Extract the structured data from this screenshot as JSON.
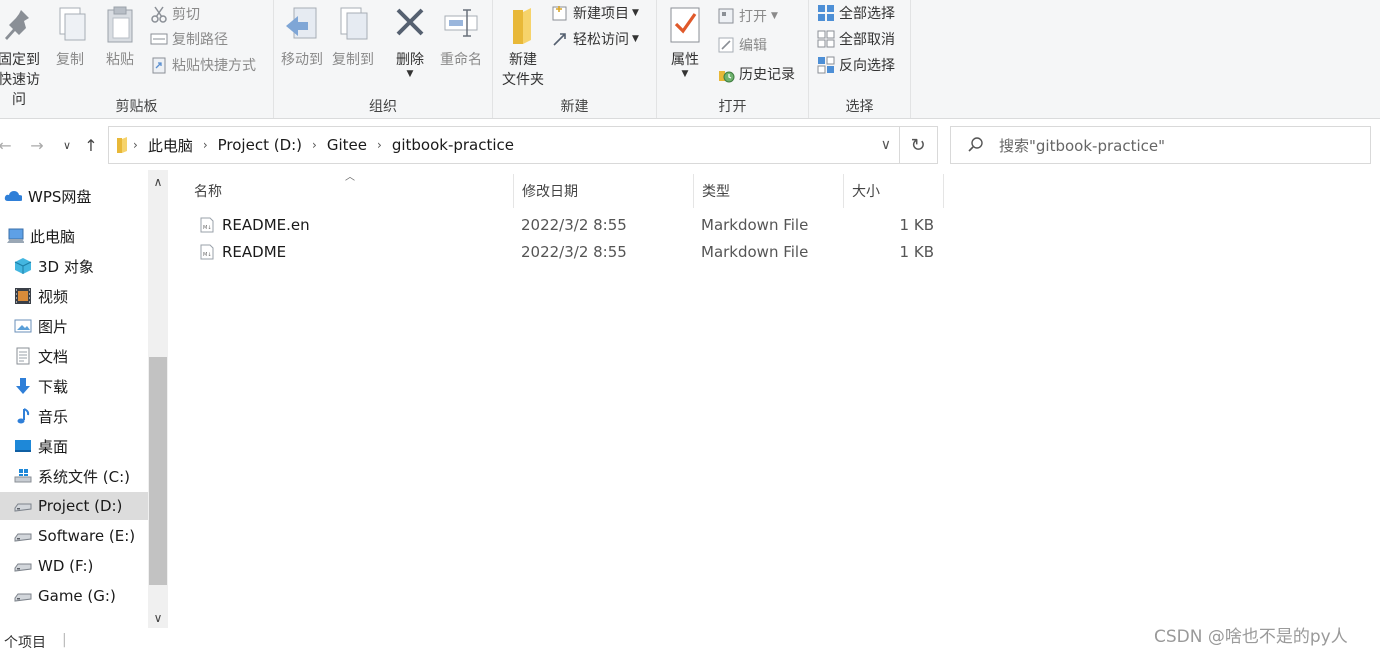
{
  "ribbon": {
    "clipboard": {
      "label": "剪贴板",
      "pin_line1": "固定到",
      "pin_line2": "快速访问",
      "copy": "复制",
      "paste": "粘贴",
      "cut": "剪切",
      "copy_path": "复制路径",
      "paste_shortcut": "粘贴快捷方式"
    },
    "organize": {
      "label": "组织",
      "move_to": "移动到",
      "copy_to": "复制到",
      "delete": "删除",
      "rename": "重命名"
    },
    "new": {
      "label": "新建",
      "new_folder_line1": "新建",
      "new_folder_line2": "文件夹",
      "new_item": "新建项目",
      "easy_access": "轻松访问"
    },
    "open": {
      "label": "打开",
      "properties": "属性",
      "open": "打开",
      "edit": "编辑",
      "history": "历史记录"
    },
    "select": {
      "label": "选择",
      "select_all": "全部选择",
      "select_none": "全部取消",
      "invert": "反向选择"
    }
  },
  "address": {
    "crumbs": [
      "此电脑",
      "Project (D:)",
      "Gitee",
      "gitbook-practice"
    ],
    "search_placeholder": "搜索\"gitbook-practice\""
  },
  "sidebar": {
    "items": [
      {
        "label": "WPS网盘",
        "icon": "cloud-icon"
      },
      {
        "label": "此电脑",
        "icon": "computer-icon"
      },
      {
        "label": "3D 对象",
        "icon": "3d-objects-icon"
      },
      {
        "label": "视频",
        "icon": "video-icon"
      },
      {
        "label": "图片",
        "icon": "pictures-icon"
      },
      {
        "label": "文档",
        "icon": "documents-icon"
      },
      {
        "label": "下载",
        "icon": "download-icon"
      },
      {
        "label": "音乐",
        "icon": "music-icon"
      },
      {
        "label": "桌面",
        "icon": "desktop-icon"
      },
      {
        "label": "系统文件 (C:)",
        "icon": "windows-drive-icon"
      },
      {
        "label": "Project (D:)",
        "icon": "drive-icon"
      },
      {
        "label": "Software (E:)",
        "icon": "drive-icon"
      },
      {
        "label": "WD (F:)",
        "icon": "drive-icon"
      },
      {
        "label": "Game (G:)",
        "icon": "drive-icon"
      }
    ]
  },
  "columns": {
    "name": "名称",
    "modified": "修改日期",
    "type": "类型",
    "size": "大小"
  },
  "files": [
    {
      "name": "README.en",
      "modified": "2022/3/2 8:55",
      "type": "Markdown File",
      "size": "1 KB"
    },
    {
      "name": "README",
      "modified": "2022/3/2 8:55",
      "type": "Markdown File",
      "size": "1 KB"
    }
  ],
  "status": {
    "count": "个项目"
  },
  "watermark": "CSDN @啥也不是的py人"
}
